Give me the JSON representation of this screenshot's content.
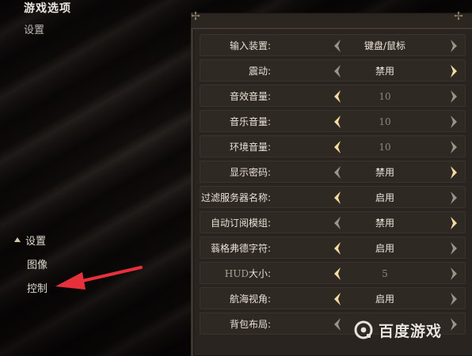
{
  "header": {
    "title": "游戏选项",
    "subtitle": "设置"
  },
  "left_nav": [
    {
      "label": "设置",
      "active": true
    },
    {
      "label": "图像"
    },
    {
      "label": "控制"
    }
  ],
  "settings": [
    {
      "label": "输入装置:",
      "value": "键盘/鼠标",
      "left_enabled": false,
      "right_enabled": false
    },
    {
      "label": "震动:",
      "value": "禁用",
      "left_enabled": false,
      "right_enabled": true
    },
    {
      "label": "音效音量:",
      "value": "10",
      "left_enabled": true,
      "right_enabled": false,
      "dim": true
    },
    {
      "label": "音乐音量:",
      "value": "10",
      "left_enabled": true,
      "right_enabled": false,
      "dim": true
    },
    {
      "label": "环境音量:",
      "value": "10",
      "left_enabled": true,
      "right_enabled": false,
      "dim": true
    },
    {
      "label": "显示密码:",
      "value": "禁用",
      "left_enabled": false,
      "right_enabled": true
    },
    {
      "label": "过滤服务器名称:",
      "value": "启用",
      "left_enabled": true,
      "right_enabled": false
    },
    {
      "label": "自动订阅模组:",
      "value": "禁用",
      "left_enabled": false,
      "right_enabled": true
    },
    {
      "label": "蓊格弗德字符:",
      "value": "启用",
      "left_enabled": true,
      "right_enabled": false
    },
    {
      "label_prefix": "HUD",
      "label": "大小:",
      "value": "5",
      "left_enabled": true,
      "right_enabled": false,
      "dim": true
    },
    {
      "label": "航海视角:",
      "value": "启用",
      "left_enabled": true,
      "right_enabled": false
    },
    {
      "label": "背包布局:",
      "value": "",
      "left_enabled": false,
      "right_enabled": false
    }
  ],
  "watermark": {
    "text": "百度游戏"
  },
  "colors": {
    "arrow_enabled": "#f3dca0",
    "arrow_disabled": "#9b948b",
    "annotation_red": "#e8303a"
  }
}
